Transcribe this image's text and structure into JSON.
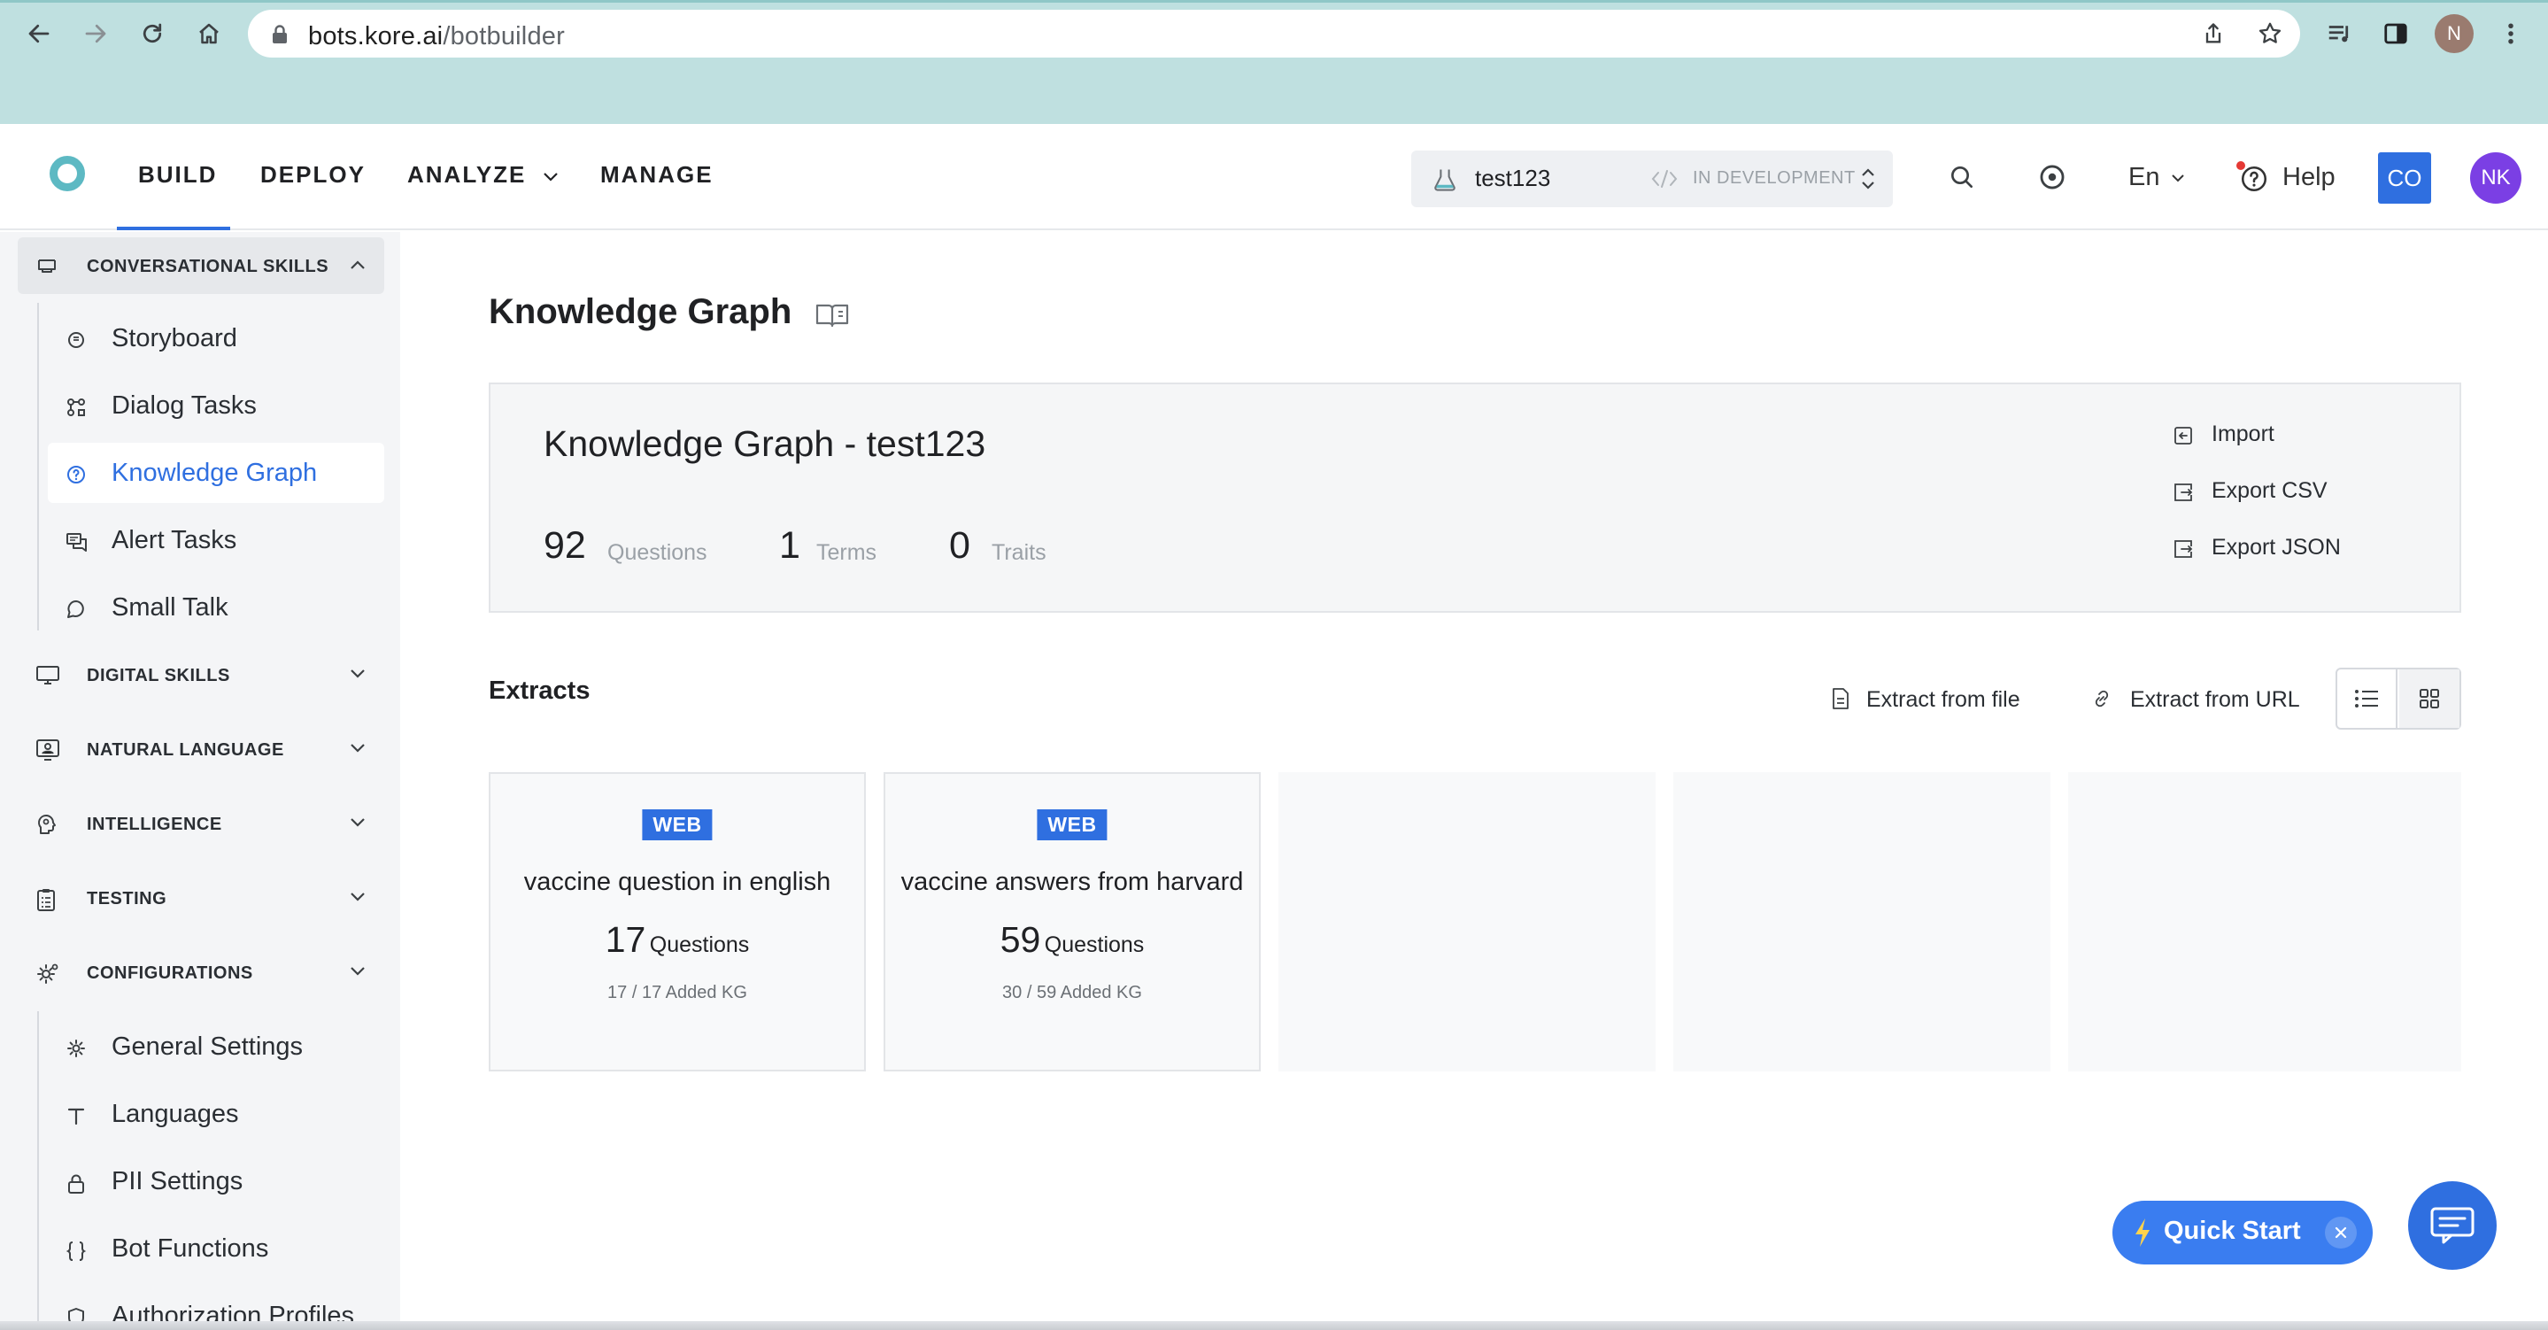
{
  "browser": {
    "url_host": "bots.kore.ai",
    "url_path": "/botbuilder",
    "profile_initial": "N"
  },
  "header": {
    "nav": {
      "build": "BUILD",
      "deploy": "DEPLOY",
      "analyze": "ANALYZE",
      "manage": "MANAGE"
    },
    "bot_name": "test123",
    "bot_status": "IN DEVELOPMENT",
    "language": "En",
    "help": "Help",
    "workspace_badge": "CO",
    "user_initials": "NK"
  },
  "sidebar": {
    "sections": {
      "conversational": "CONVERSATIONAL SKILLS",
      "digital": "DIGITAL SKILLS",
      "natural_language": "NATURAL LANGUAGE",
      "intelligence": "INTELLIGENCE",
      "testing": "TESTING",
      "configurations": "CONFIGURATIONS"
    },
    "conversational_items": [
      "Storyboard",
      "Dialog Tasks",
      "Knowledge Graph",
      "Alert Tasks",
      "Small Talk"
    ],
    "configuration_items": [
      "General Settings",
      "Languages",
      "PII Settings",
      "Bot Functions",
      "Authorization Profiles"
    ]
  },
  "main": {
    "page_title": "Knowledge Graph",
    "kg_title": "Knowledge Graph - test123",
    "stats": {
      "questions_value": "92",
      "questions_label": "Questions",
      "terms_value": "1",
      "terms_label": "Terms",
      "traits_value": "0",
      "traits_label": "Traits"
    },
    "actions": {
      "import": "Import",
      "export_csv": "Export CSV",
      "export_json": "Export JSON"
    },
    "extracts_title": "Extracts",
    "extract_from_file": "Extract from file",
    "extract_from_url": "Extract from URL",
    "extracts": [
      {
        "badge": "WEB",
        "title": "vaccine question in english",
        "questions_value": "17",
        "questions_label": "Questions",
        "added": "17 / 17 Added KG"
      },
      {
        "badge": "WEB",
        "title": "vaccine answers from harvard",
        "questions_value": "59",
        "questions_label": "Questions",
        "added": "30 / 59 Added KG"
      }
    ]
  },
  "quick_start": "Quick Start",
  "colors": {
    "accent": "#2f6fe0",
    "chrome": "#bfe0e0",
    "sidebar": "#f4f5f7"
  }
}
